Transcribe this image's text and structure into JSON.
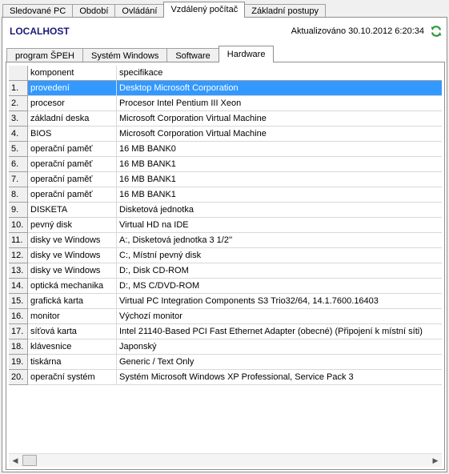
{
  "top_tabs": [
    "Sledované PC",
    "Období",
    "Ovládání",
    "Vzdálený počítač",
    "Základní postupy"
  ],
  "host": "LOCALHOST",
  "updated": "Aktualizováno 30.10.2012 6:20:34",
  "sub_tabs": [
    "program ŠPEH",
    "Systém Windows",
    "Software",
    "Hardware"
  ],
  "grid": {
    "headers": [
      "komponent",
      "specifikace"
    ],
    "rows": [
      {
        "num": "1.",
        "komponent": "provedení",
        "specifikace": "Desktop Microsoft Corporation"
      },
      {
        "num": "2.",
        "komponent": "procesor",
        "specifikace": "Procesor Intel Pentium III Xeon"
      },
      {
        "num": "3.",
        "komponent": "základní deska",
        "specifikace": "Microsoft Corporation Virtual Machine"
      },
      {
        "num": "4.",
        "komponent": "BIOS",
        "specifikace": "Microsoft Corporation Virtual Machine"
      },
      {
        "num": "5.",
        "komponent": "operační paměť",
        "specifikace": "16 MB BANK0"
      },
      {
        "num": "6.",
        "komponent": "operační paměť",
        "specifikace": "16 MB BANK1"
      },
      {
        "num": "7.",
        "komponent": "operační paměť",
        "specifikace": "16 MB BANK1"
      },
      {
        "num": "8.",
        "komponent": "operační paměť",
        "specifikace": "16 MB BANK1"
      },
      {
        "num": "9.",
        "komponent": "DISKETA",
        "specifikace": "Disketová jednotka"
      },
      {
        "num": "10.",
        "komponent": "pevný disk",
        "specifikace": "Virtual HD na IDE"
      },
      {
        "num": "11.",
        "komponent": "disky ve Windows",
        "specifikace": "A:, Disketová jednotka 3 1/2''"
      },
      {
        "num": "12.",
        "komponent": "disky ve Windows",
        "specifikace": "C:, Místní pevný disk"
      },
      {
        "num": "13.",
        "komponent": "disky ve Windows",
        "specifikace": "D:, Disk CD-ROM"
      },
      {
        "num": "14.",
        "komponent": "optická mechanika",
        "specifikace": "D:, MS C/DVD-ROM"
      },
      {
        "num": "15.",
        "komponent": "grafická karta",
        "specifikace": "Virtual PC Integration Components S3 Trio32/64, 14.1.7600.16403"
      },
      {
        "num": "16.",
        "komponent": "monitor",
        "specifikace": "Výchozí monitor"
      },
      {
        "num": "17.",
        "komponent": "síťová karta",
        "specifikace": "Intel 21140-Based PCI Fast Ethernet Adapter (obecné) (Připojení k místní síti)"
      },
      {
        "num": "18.",
        "komponent": "klávesnice",
        "specifikace": "Japonský"
      },
      {
        "num": "19.",
        "komponent": "tiskárna",
        "specifikace": "Generic / Text Only"
      },
      {
        "num": "20.",
        "komponent": "operační systém",
        "specifikace": "Systém Microsoft Windows XP Professional, Service Pack 3"
      }
    ]
  },
  "colors": {
    "selection": "#3399ff",
    "host": "#1a1a7a",
    "refresh": "#2a9a3a"
  },
  "icons": {
    "refresh": "refresh-icon",
    "scroll_left": "arrow-left-icon",
    "scroll_right": "arrow-right-icon"
  }
}
